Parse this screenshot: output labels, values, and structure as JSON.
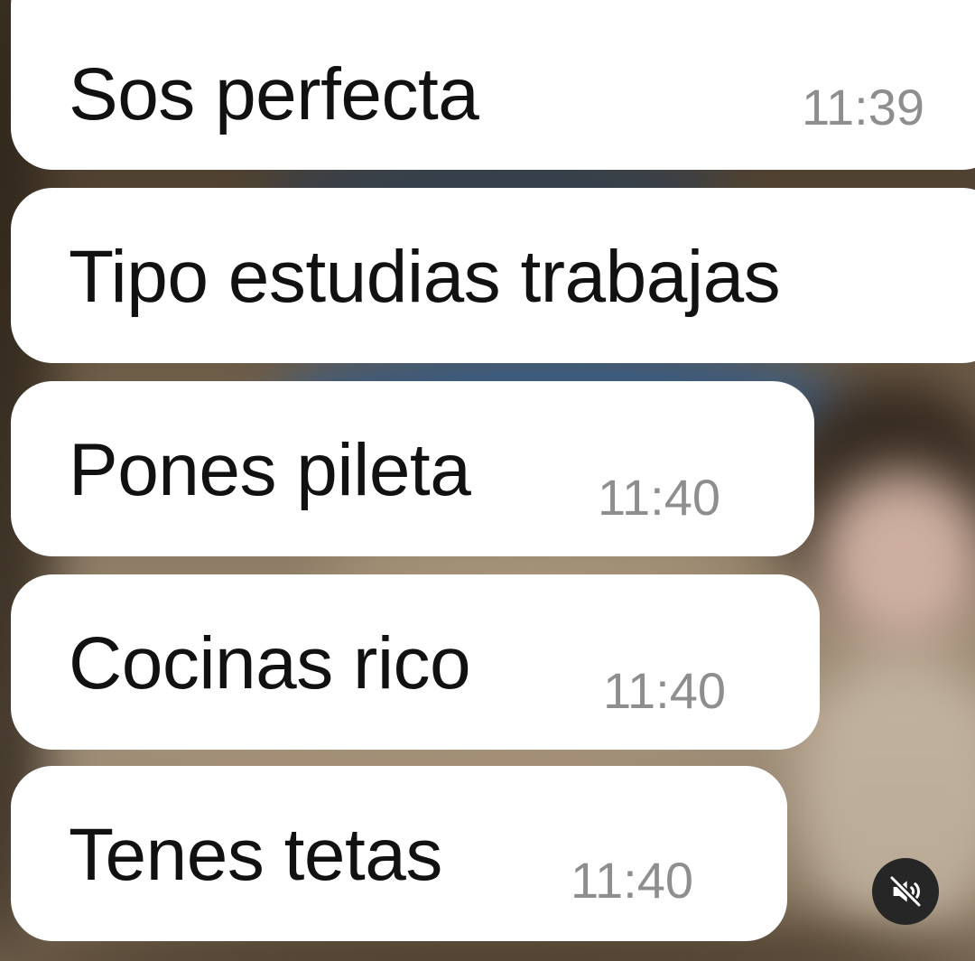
{
  "messages": [
    {
      "text": "Sos perfecta",
      "time": "11:39"
    },
    {
      "text": "Tipo estudias trabajas",
      "time": ""
    },
    {
      "text": "Pones pileta",
      "time": "11:40"
    },
    {
      "text": "Cocinas rico",
      "time": "11:40"
    },
    {
      "text": "Tenes tetas",
      "time": "11:40"
    }
  ],
  "controls": {
    "mute_icon": "speaker-muted-icon"
  },
  "colors": {
    "bubble": "#ffffff",
    "text": "#111111",
    "timestamp": "#8e8e8e",
    "mute_button": "#262626"
  }
}
